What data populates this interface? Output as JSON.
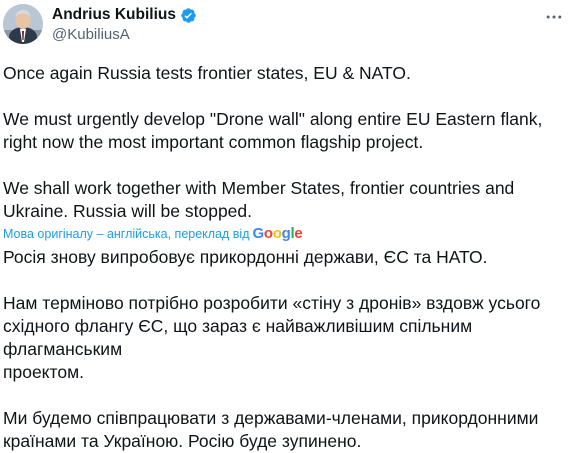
{
  "author": {
    "name": "Andrius Kubilius",
    "handle": "@KubiliusA"
  },
  "original_paragraphs": [
    "Once again Russia tests frontier states, EU & NATO.",
    "We must urgently develop \"Drone wall\" along entire EU Eastern flank, right now the most important common flagship project.",
    "We shall work together with Member States, frontier countries and Ukraine. Russia will be stopped."
  ],
  "translation_notice": {
    "label": "Мова оригіналу – англійська, переклад від",
    "provider": "Google"
  },
  "translated_paragraphs": [
    "Росія знову випробовує прикордонні держави, ЄС та НАТО.",
    "Нам терміново потрібно розробити «стіну з дронів» вздовж усього\nсхідного флангу ЄС, що зараз є найважливішим спільним флагманським\nпроектом.",
    "Ми будемо співпрацювати з державами-членами, прикордонними\nкраїнами та Україною. Росію буде зупинено."
  ],
  "colors": {
    "verified_badge": "#1d9bf0",
    "link": "#1d9bf0",
    "secondary_text": "#536471"
  },
  "icons": {
    "verified": "verified-badge-icon",
    "more": "more-options-icon"
  }
}
